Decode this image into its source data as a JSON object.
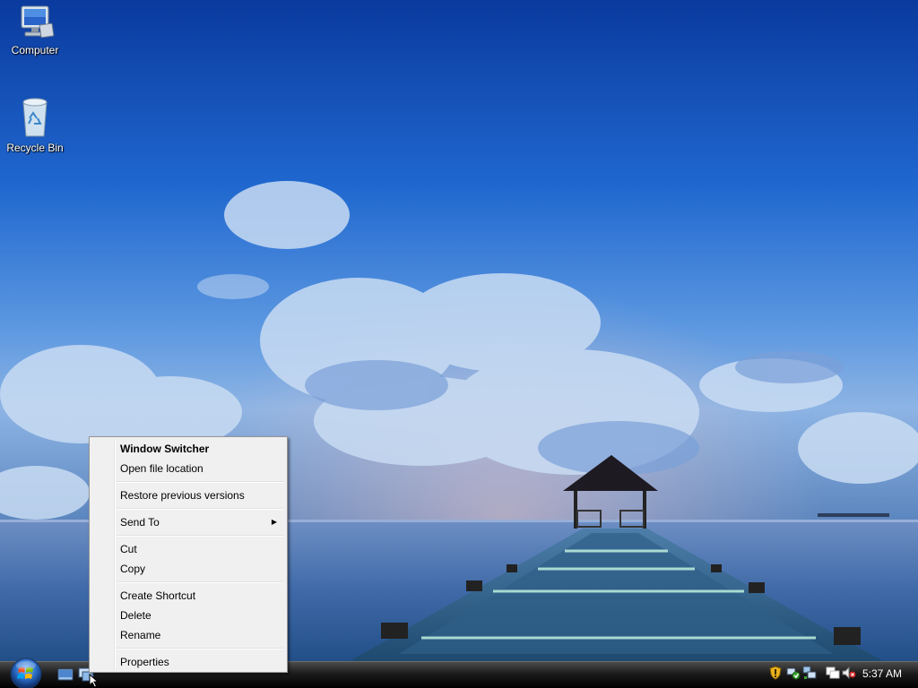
{
  "desktop": {
    "icons": [
      {
        "label": "Computer",
        "icon": "computer-icon"
      },
      {
        "label": "Recycle Bin",
        "icon": "recycle-bin-icon"
      }
    ]
  },
  "context_menu": {
    "items": [
      {
        "label": "Window Switcher",
        "bold": true
      },
      {
        "label": "Open file location"
      },
      {
        "label": "Restore previous versions"
      },
      {
        "label": "Send To",
        "submenu": true
      },
      {
        "label": "Cut"
      },
      {
        "label": "Copy"
      },
      {
        "label": "Create Shortcut"
      },
      {
        "label": "Delete"
      },
      {
        "label": "Rename"
      },
      {
        "label": "Properties"
      }
    ],
    "submenu_arrow": "▶"
  },
  "taskbar": {
    "start_button": "start-orb-icon",
    "quick_launch": [
      "show-desktop-icon",
      "window-switcher-icon"
    ],
    "tray_icons": [
      "windows-security-shield-icon",
      "network-status-icon",
      "network-connection-icon",
      "volume-muted-icon"
    ],
    "clock": "5:37 AM"
  },
  "colors": {
    "taskbar": "#1b1b1b",
    "menu_background": "#f0f0f0",
    "menu_border": "#979797"
  }
}
